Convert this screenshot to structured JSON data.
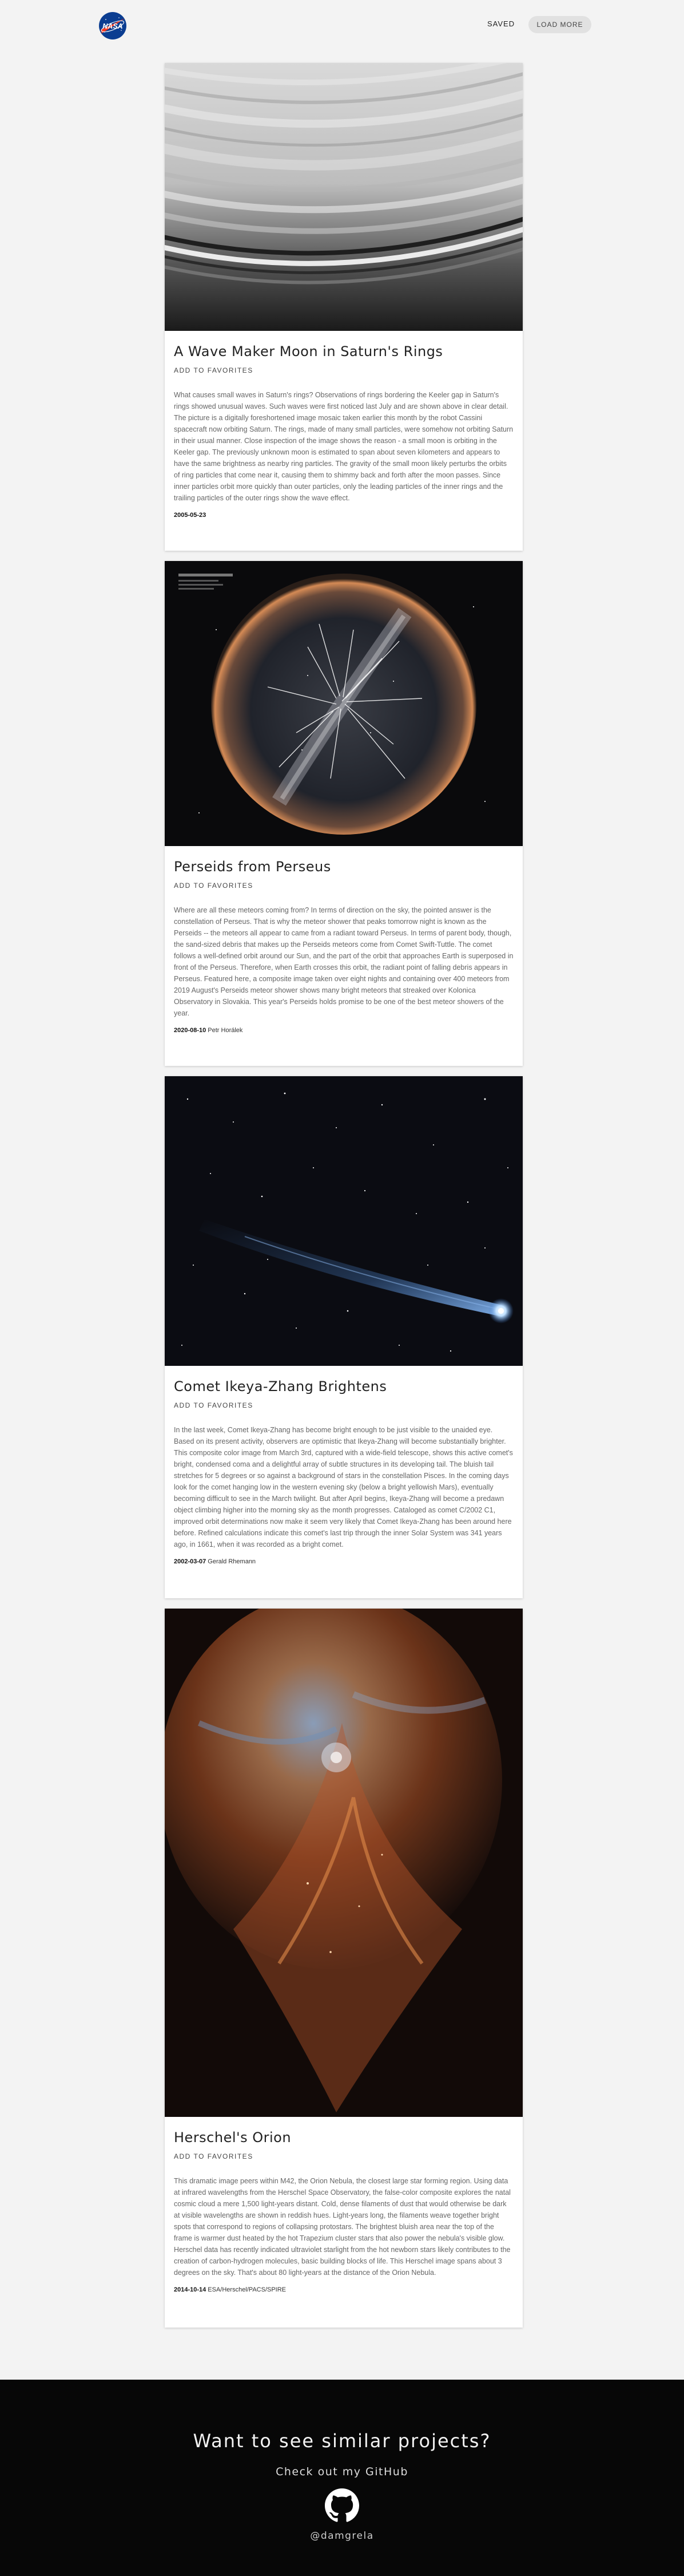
{
  "header": {
    "logo_icon": "nasa-logo",
    "logo_text": "NASA",
    "saved_label": "SAVED",
    "load_more_label": "LOAD MORE"
  },
  "cards": [
    {
      "title": "A Wave Maker Moon in Saturn's Rings",
      "favorite_label": "ADD TO FAVORITES",
      "image_icon": "saturn-rings-image",
      "description": "What causes small waves in Saturn's rings? Observations of rings bordering the Keeler gap in Saturn's rings showed unusual waves. Such waves were first noticed last July and are shown above in clear detail. The picture is a digitally foreshortened image mosaic taken earlier this month by the robot Cassini spacecraft now orbiting Saturn. The rings, made of many small particles, were somehow not orbiting Saturn in their usual manner. Close inspection of the image shows the reason - a small moon is orbiting in the Keeler gap. The previously unknown moon is estimated to span about seven kilometers and appears to have the same brightness as nearby ring particles. The gravity of the small moon likely perturbs the orbits of ring particles that come near it, causing them to shimmy back and forth after the moon passes. Since inner particles orbit more quickly than outer particles, only the leading particles of the inner rings and the trailing particles of the outer rings show the wave effect.",
      "date": "2005-05-23",
      "credit": ""
    },
    {
      "title": "Perseids from Perseus",
      "favorite_label": "ADD TO FAVORITES",
      "image_icon": "perseids-allsky-image",
      "description": "Where are all these meteors coming from? In terms of direction on the sky, the pointed answer is the constellation of Perseus. That is why the meteor shower that peaks tomorrow night is known as the Perseids -- the meteors all appear to came from a radiant toward Perseus. In terms of parent body, though, the sand-sized debris that makes up the Perseids meteors come from Comet Swift-Tuttle. The comet follows a well-defined orbit around our Sun, and the part of the orbit that approaches Earth is superposed in front of the Perseus. Therefore, when Earth crosses this orbit, the radiant point of falling debris appears in Perseus. Featured here, a composite image taken over eight nights and containing over 400 meteors from 2019 August's Perseids meteor shower shows many bright meteors that streaked over Kolonica Observatory in Slovakia. This year's Perseids holds promise to be one of the best meteor showers of the year.",
      "date": "2020-08-10",
      "credit": "Petr Horálek"
    },
    {
      "title": "Comet Ikeya-Zhang Brightens",
      "favorite_label": "ADD TO FAVORITES",
      "image_icon": "comet-image",
      "description": "In the last week, Comet Ikeya-Zhang has become bright enough to be just visible to the unaided eye. Based on its present activity, observers are optimistic that Ikeya-Zhang will become substantially brighter. This composite color image from March 3rd, captured with a wide-field telescope, shows this active comet's bright, condensed coma and a delightful array of subtle structures in its developing tail. The bluish tail stretches for 5 degrees or so against a background of stars in the constellation Pisces. In the coming days look for the comet hanging low in the western evening sky (below a bright yellowish Mars), eventually becoming difficult to see in the March twilight. But after April begins, Ikeya-Zhang will become a predawn object climbing higher into the morning sky as the month progresses. Cataloged as comet C/2002 C1, improved orbit determinations now make it seem very likely that Comet Ikeya-Zhang has been around here before. Refined calculations indicate this comet's last trip through the inner Solar System was 341 years ago, in 1661, when it was recorded as a bright comet.",
      "date": "2002-03-07",
      "credit": "Gerald Rhemann"
    },
    {
      "title": "Herschel's Orion",
      "favorite_label": "ADD TO FAVORITES",
      "image_icon": "orion-nebula-image",
      "description": "This dramatic image peers within M42, the Orion Nebula, the closest large star forming region. Using data at infrared wavelengths from the Herschel Space Observatory, the false-color composite explores the natal cosmic cloud a mere 1,500 light-years distant. Cold, dense filaments of dust that would otherwise be dark at visible wavelengths are shown in reddish hues. Light-years long, the filaments weave together bright spots that correspond to regions of collapsing protostars. The brightest bluish area near the top of the frame is warmer dust heated by the hot Trapezium cluster stars that also power the nebula's visible glow. Herschel data has recently indicated ultraviolet starlight from the hot newborn stars likely contributes to the creation of carbon-hydrogen molecules, basic building blocks of life. This Herschel image spans about 3 degrees on the sky. That's about 80 light-years at the distance of the Orion Nebula.",
      "date": "2014-10-14",
      "credit": "ESA/Herschel/PACS/SPIRE"
    }
  ],
  "footer": {
    "title": "Want to see similar projects?",
    "subtitle": "Check out my GitHub",
    "github_icon": "github-icon",
    "handle": "@damgrela"
  }
}
